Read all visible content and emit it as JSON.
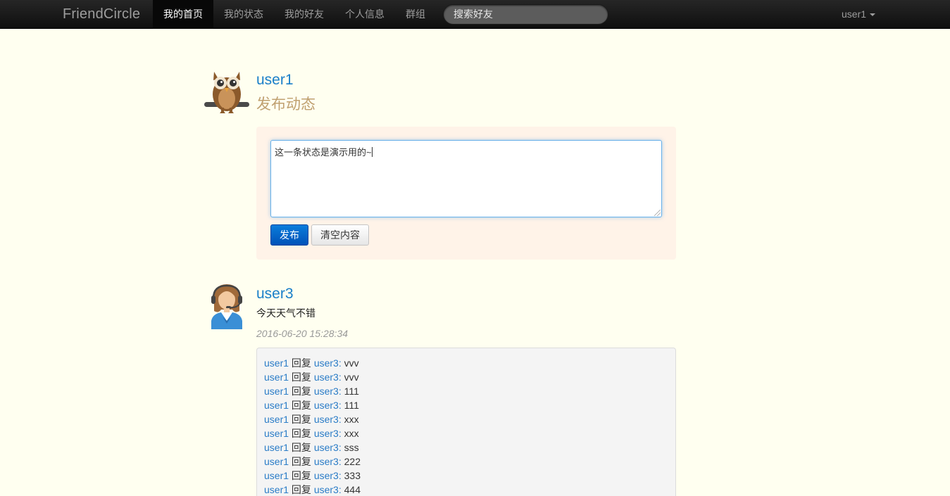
{
  "navbar": {
    "brand": "FriendCircle",
    "items": [
      {
        "label": "我的首页",
        "active": true
      },
      {
        "label": "我的状态",
        "active": false
      },
      {
        "label": "我的好友",
        "active": false
      },
      {
        "label": "个人信息",
        "active": false
      },
      {
        "label": "群组",
        "active": false
      }
    ],
    "search_placeholder": "搜索好友",
    "user_menu": "user1"
  },
  "composer": {
    "username": "user1",
    "subtitle": "发布动态",
    "avatar_icon": "owl-avatar-icon",
    "textarea_value": "这一条状态是演示用的~",
    "publish_label": "发布",
    "clear_label": "清空内容"
  },
  "post": {
    "username": "user3",
    "avatar_icon": "support-agent-avatar-icon",
    "content": "今天天气不错",
    "timestamp": "2016-06-20 15:28:34",
    "reply_word": "回复",
    "replies": [
      {
        "from": "user1",
        "to": "user3:",
        "text": "vvv"
      },
      {
        "from": "user1",
        "to": "user3:",
        "text": "vvv"
      },
      {
        "from": "user1",
        "to": "user3:",
        "text": "111"
      },
      {
        "from": "user1",
        "to": "user3:",
        "text": "111"
      },
      {
        "from": "user1",
        "to": "user3:",
        "text": "xxx"
      },
      {
        "from": "user1",
        "to": "user3:",
        "text": "xxx"
      },
      {
        "from": "user1",
        "to": "user3:",
        "text": "sss"
      },
      {
        "from": "user1",
        "to": "user3:",
        "text": "222"
      },
      {
        "from": "user1",
        "to": "user3:",
        "text": "333"
      },
      {
        "from": "user1",
        "to": "user3:",
        "text": "444"
      }
    ]
  },
  "colors": {
    "page_bg": "#fffff0",
    "link": "#2a7cc7",
    "primary_button": "#0066cc",
    "composer_bg": "#fff3e8"
  }
}
